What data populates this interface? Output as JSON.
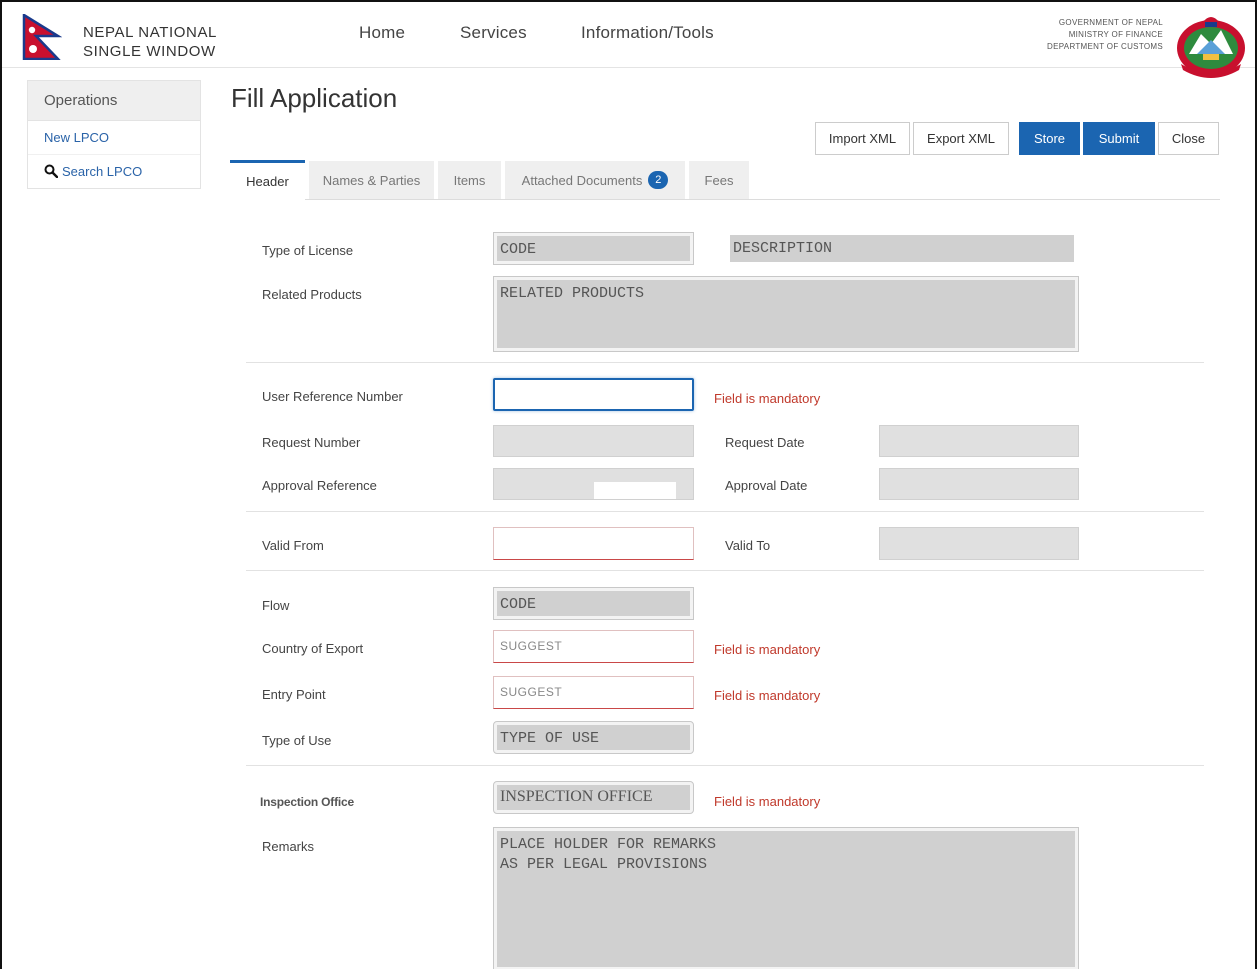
{
  "header": {
    "brand_line1": "NEPAL NATIONAL",
    "brand_line2": "SINGLE WINDOW",
    "nav": [
      "Home",
      "Services",
      "Information/Tools"
    ],
    "gov_line1": "GOVERNMENT OF NEPAL",
    "gov_line2": "MINISTRY OF FINANCE",
    "gov_line3": "DEPARTMENT OF CUSTOMS"
  },
  "sidebar": {
    "title": "Operations",
    "items": [
      {
        "label": "New LPCO"
      },
      {
        "label": "Search LPCO"
      }
    ]
  },
  "main": {
    "title": "Fill Application",
    "buttons": {
      "import": "Import XML",
      "export": "Export XML",
      "store": "Store",
      "submit": "Submit",
      "close": "Close"
    },
    "tabs": [
      {
        "label": "Header"
      },
      {
        "label": "Names & Parties"
      },
      {
        "label": "Items"
      },
      {
        "label": "Attached Documents",
        "badge": "2"
      },
      {
        "label": "Fees"
      }
    ]
  },
  "form": {
    "type_of_license": {
      "label": "Type of License",
      "code": "CODE",
      "description": "DESCRIPTION"
    },
    "related_products": {
      "label": "Related Products",
      "value": "RELATED PRODUCTS"
    },
    "user_reference": {
      "label": "User Reference Number",
      "error": "Field is mandatory"
    },
    "request_number": {
      "label": "Request Number"
    },
    "request_date": {
      "label": "Request Date"
    },
    "approval_reference": {
      "label": "Approval Reference"
    },
    "approval_date": {
      "label": "Approval Date"
    },
    "valid_from": {
      "label": "Valid From"
    },
    "valid_to": {
      "label": "Valid To"
    },
    "flow": {
      "label": "Flow",
      "value": "CODE"
    },
    "country_of_export": {
      "label": "Country of Export",
      "placeholder": "SUGGEST",
      "error": "Field is mandatory"
    },
    "entry_point": {
      "label": "Entry Point",
      "placeholder": "SUGGEST",
      "error": "Field is mandatory"
    },
    "type_of_use": {
      "label": "Type of Use",
      "value": "TYPE OF USE"
    },
    "inspection_office": {
      "label": "Inspection Office",
      "value": "INSPECTION OFFICE",
      "error": "Field is mandatory"
    },
    "remarks": {
      "label": "Remarks",
      "value": "PLACE HOLDER FOR REMARKS\nAS PER LEGAL PROVISIONS"
    }
  },
  "colors": {
    "primary": "#1b65b1",
    "error": "#c0392b",
    "link": "#2a63a8"
  }
}
